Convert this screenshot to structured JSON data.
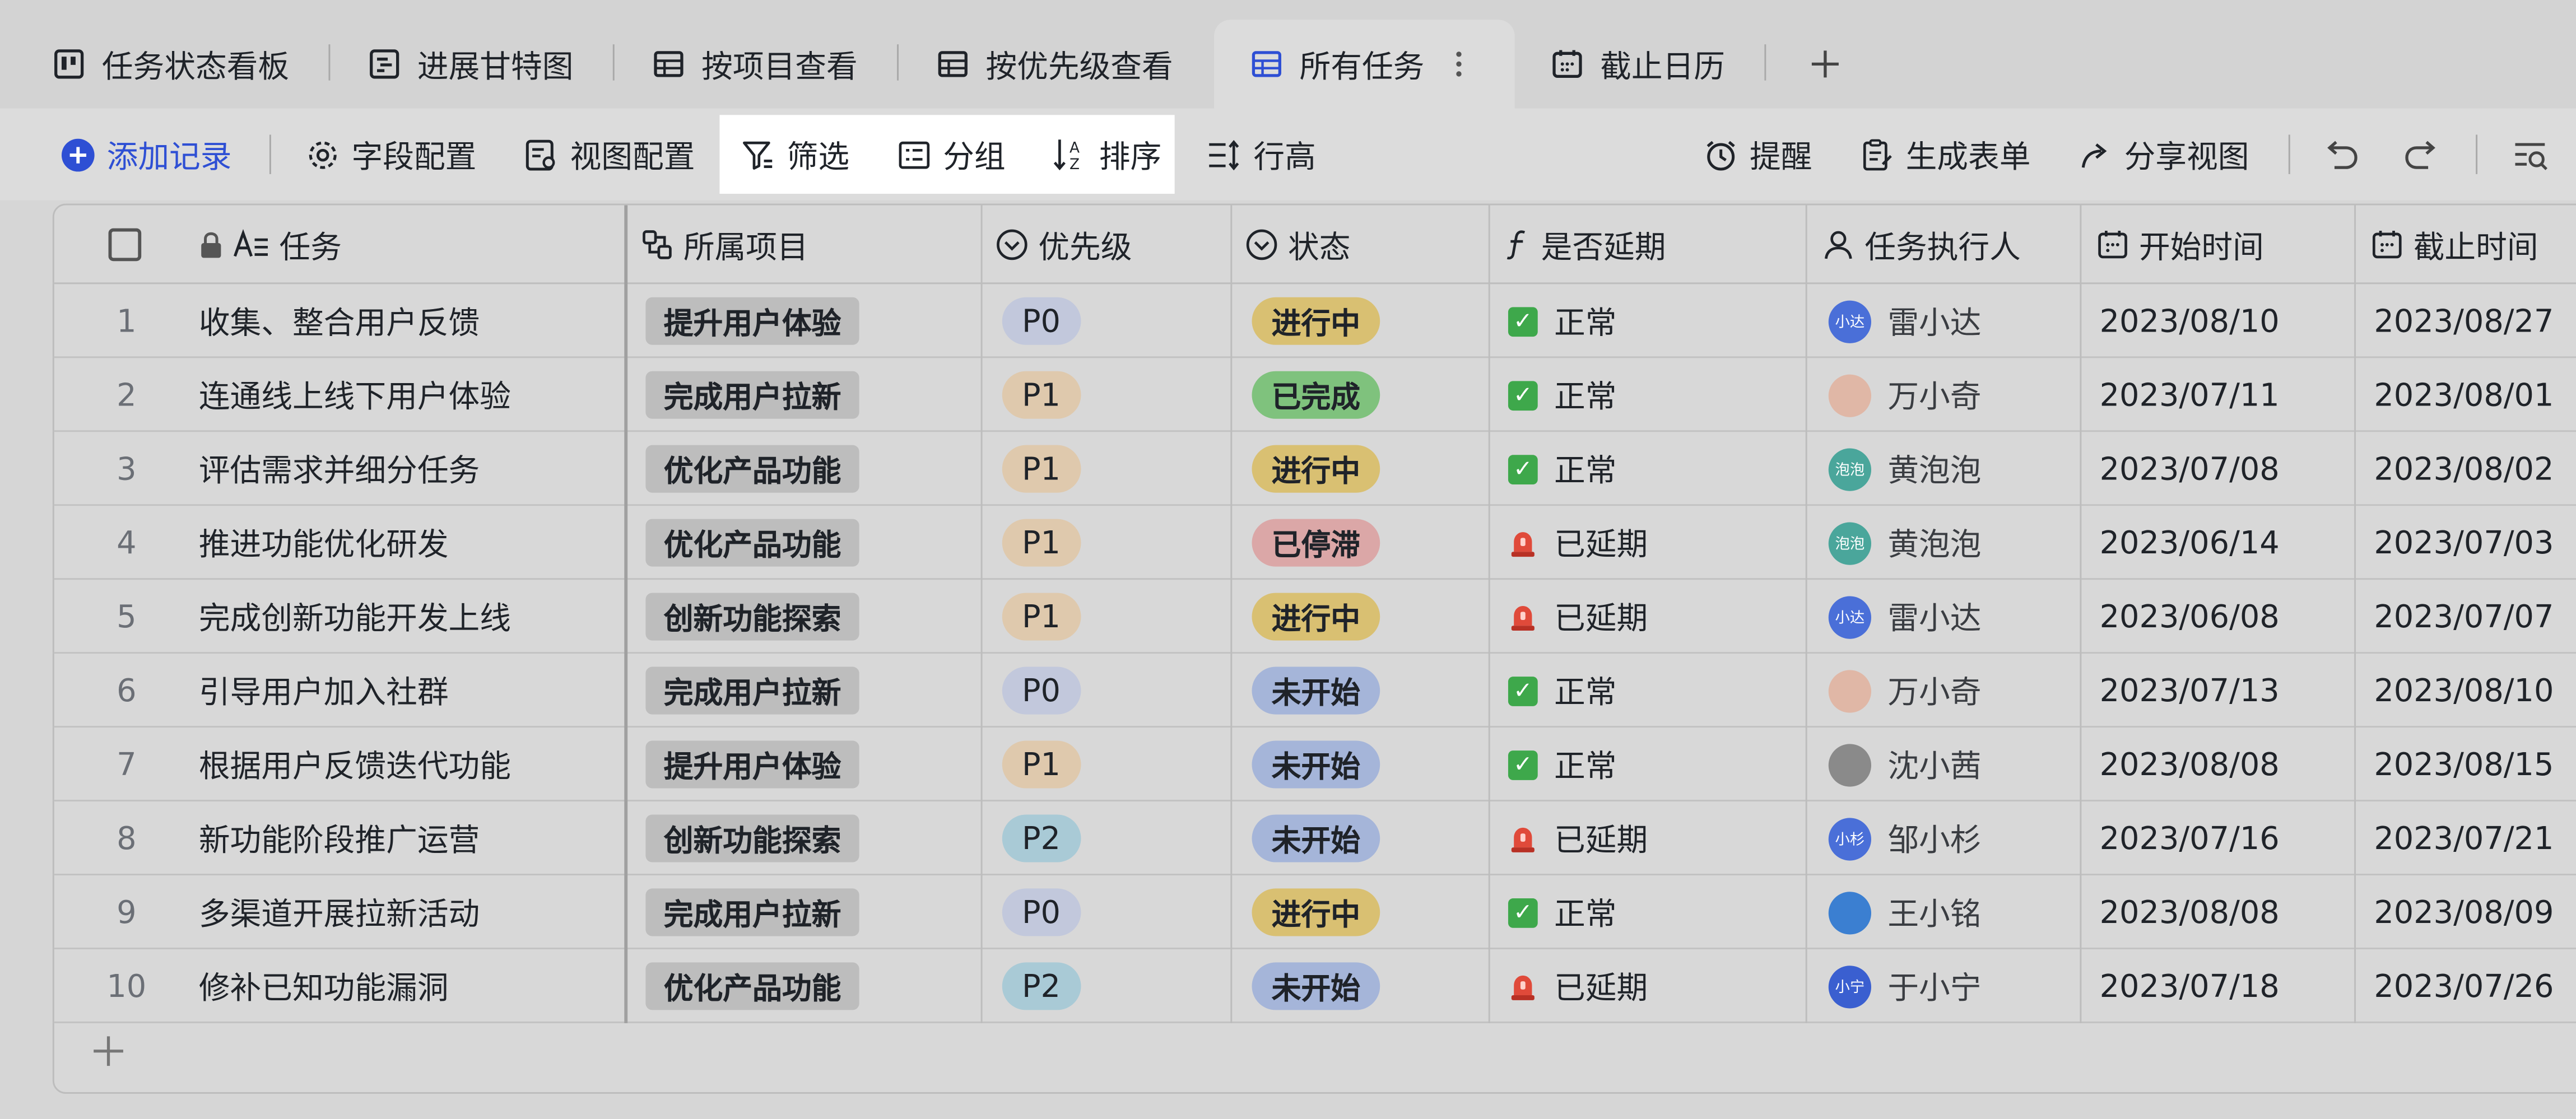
{
  "tabs": [
    {
      "label": "任务状态看板",
      "icon": "kanban-icon"
    },
    {
      "label": "进展甘特图",
      "icon": "gantt-icon"
    },
    {
      "label": "按项目查看",
      "icon": "grid-icon"
    },
    {
      "label": "按优先级查看",
      "icon": "grid-icon"
    },
    {
      "label": "所有任务",
      "icon": "grid-icon",
      "active": true
    },
    {
      "label": "截止日历",
      "icon": "calendar-icon"
    }
  ],
  "toolbar": {
    "add_record": "添加记录",
    "field_config": "字段配置",
    "view_config": "视图配置",
    "filter": "筛选",
    "group": "分组",
    "sort": "排序",
    "row_height": "行高",
    "reminder": "提醒",
    "generate_form": "生成表单",
    "share_view": "分享视图"
  },
  "columns": {
    "task": "任务",
    "project": "所属项目",
    "priority": "优先级",
    "status": "状态",
    "delayed": "是否延期",
    "assignee": "任务执行人",
    "start": "开始时间",
    "due": "截止时间"
  },
  "colors": {
    "accent": "#2e4fd4",
    "p0": "#c2c8dc",
    "p1": "#dfc9ad",
    "p2": "#a9cad6",
    "in_progress": "#d9c072",
    "done": "#7fc27d",
    "stalled": "#dba7a7",
    "not_started": "#a5b5d9"
  },
  "rows": [
    {
      "num": "1",
      "task": "收集、整合用户反馈",
      "project": "提升用户体验",
      "priority": "P0",
      "status": "进行中",
      "delay_icon": "check",
      "delay": "正常",
      "avatar_text": "小达",
      "avatar_color": "#4a6fd8",
      "assignee": "雷小达",
      "start": "2023/08/10",
      "due": "2023/08/27"
    },
    {
      "num": "2",
      "task": "连通线上线下用户体验",
      "project": "完成用户拉新",
      "priority": "P1",
      "status": "已完成",
      "delay_icon": "check",
      "delay": "正常",
      "avatar_text": "",
      "avatar_color": "#e0b7a6",
      "assignee": "万小奇",
      "start": "2023/07/11",
      "due": "2023/08/01"
    },
    {
      "num": "3",
      "task": "评估需求并细分任务",
      "project": "优化产品功能",
      "priority": "P1",
      "status": "进行中",
      "delay_icon": "check",
      "delay": "正常",
      "avatar_text": "泡泡",
      "avatar_color": "#4aa69b",
      "assignee": "黄泡泡",
      "start": "2023/07/08",
      "due": "2023/08/02"
    },
    {
      "num": "4",
      "task": "推进功能优化研发",
      "project": "优化产品功能",
      "priority": "P1",
      "status": "已停滞",
      "delay_icon": "alarm",
      "delay": "已延期",
      "avatar_text": "泡泡",
      "avatar_color": "#4aa69b",
      "assignee": "黄泡泡",
      "start": "2023/06/14",
      "due": "2023/07/03"
    },
    {
      "num": "5",
      "task": "完成创新功能开发上线",
      "project": "创新功能探索",
      "priority": "P1",
      "status": "进行中",
      "delay_icon": "alarm",
      "delay": "已延期",
      "avatar_text": "小达",
      "avatar_color": "#4a6fd8",
      "assignee": "雷小达",
      "start": "2023/06/08",
      "due": "2023/07/07"
    },
    {
      "num": "6",
      "task": "引导用户加入社群",
      "project": "完成用户拉新",
      "priority": "P0",
      "status": "未开始",
      "delay_icon": "check",
      "delay": "正常",
      "avatar_text": "",
      "avatar_color": "#e0b7a6",
      "assignee": "万小奇",
      "start": "2023/07/13",
      "due": "2023/08/10"
    },
    {
      "num": "7",
      "task": "根据用户反馈迭代功能",
      "project": "提升用户体验",
      "priority": "P1",
      "status": "未开始",
      "delay_icon": "check",
      "delay": "正常",
      "avatar_text": "",
      "avatar_color": "#8a8a8a",
      "assignee": "沈小茜",
      "start": "2023/08/08",
      "due": "2023/08/15"
    },
    {
      "num": "8",
      "task": "新功能阶段推广运营",
      "project": "创新功能探索",
      "priority": "P2",
      "status": "未开始",
      "delay_icon": "alarm",
      "delay": "已延期",
      "avatar_text": "小杉",
      "avatar_color": "#4a6fd8",
      "assignee": "邹小杉",
      "start": "2023/07/16",
      "due": "2023/07/21"
    },
    {
      "num": "9",
      "task": "多渠道开展拉新活动",
      "project": "完成用户拉新",
      "priority": "P0",
      "status": "进行中",
      "delay_icon": "check",
      "delay": "正常",
      "avatar_text": "",
      "avatar_color": "#3b7fd1",
      "assignee": "王小铭",
      "start": "2023/08/08",
      "due": "2023/08/09"
    },
    {
      "num": "10",
      "task": "修补已知功能漏洞",
      "project": "优化产品功能",
      "priority": "P2",
      "status": "未开始",
      "delay_icon": "alarm",
      "delay": "已延期",
      "avatar_text": "小宁",
      "avatar_color": "#3a5fd0",
      "assignee": "于小宁",
      "start": "2023/07/18",
      "due": "2023/07/26"
    }
  ]
}
